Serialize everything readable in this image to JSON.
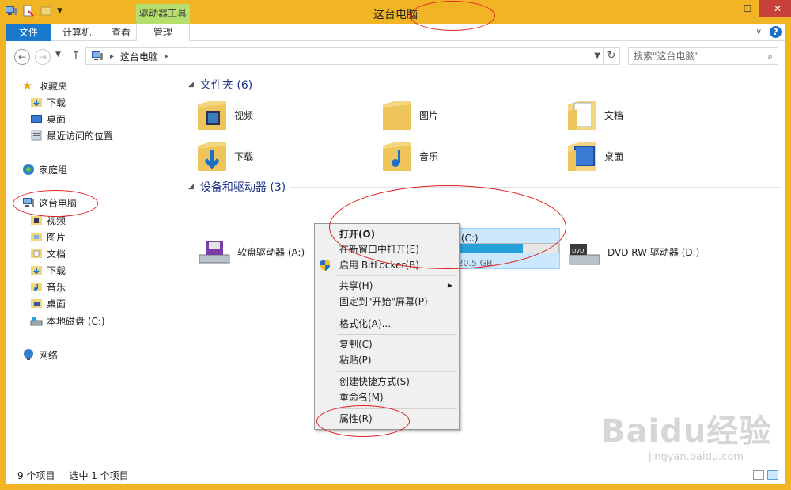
{
  "window": {
    "title": "这台电脑",
    "context_tab_header": "驱动器工具",
    "controls": {
      "minimize": "—",
      "maximize": "☐",
      "close": "✕"
    }
  },
  "ribbon": {
    "tabs": [
      {
        "label": "文件"
      },
      {
        "label": "计算机"
      },
      {
        "label": "查看"
      },
      {
        "label": "管理"
      }
    ],
    "help": "?"
  },
  "address": {
    "crumb": "这台电脑",
    "search_placeholder": "搜索\"这台电脑\""
  },
  "nav": {
    "favorites": "收藏夹",
    "fav_items": [
      "下载",
      "桌面",
      "最近访问的位置"
    ],
    "homegroup": "家庭组",
    "this_pc": "这台电脑",
    "pc_items": [
      "视频",
      "图片",
      "文档",
      "下载",
      "音乐",
      "桌面",
      "本地磁盘 (C:)"
    ],
    "network": "网络"
  },
  "content": {
    "folders_header": "文件夹 (6)",
    "folders": [
      "视频",
      "图片",
      "文档",
      "下载",
      "音乐",
      "桌面"
    ],
    "devices_header": "设备和驱动器 (3)",
    "drive_a": "软盘驱动器 (A:)",
    "drive_c": {
      "name": "本地磁盘 (C:)",
      "free": "可用，共 20.5 GB",
      "used_fraction": 0.74
    },
    "drive_d": "DVD RW 驱动器 (D:)"
  },
  "context_menu": {
    "open": "打开(O)",
    "open_new": "在新窗口中打开(E)",
    "bitlocker": "启用 BitLocker(B)",
    "share": "共享(H)",
    "pin_start": "固定到\"开始\"屏幕(P)",
    "format": "格式化(A)...",
    "copy": "复制(C)",
    "paste": "粘贴(P)",
    "shortcut": "创建快捷方式(S)",
    "rename": "重命名(M)",
    "properties": "属性(R)"
  },
  "status": {
    "count": "9 个项目",
    "selected": "选中 1 个项目"
  },
  "watermark": {
    "brand": "Baidu经验",
    "url": "jingyan.baidu.com"
  }
}
